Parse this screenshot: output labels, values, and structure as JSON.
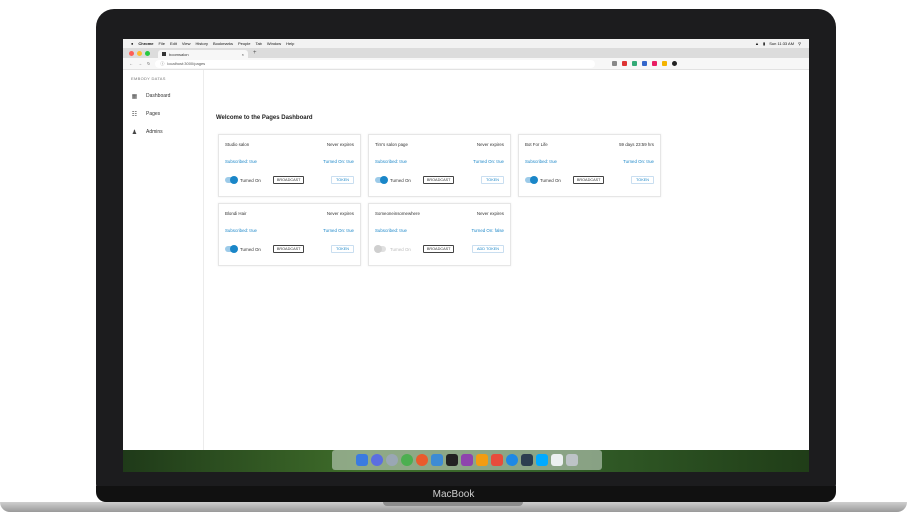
{
  "menubar": {
    "app": "Chrome",
    "items": [
      "File",
      "Edit",
      "View",
      "History",
      "Bookmarks",
      "People",
      "Tab",
      "Window",
      "Help"
    ],
    "clock": "Sun 11:33 AM"
  },
  "tab": {
    "title": "boomsalon",
    "close": "×",
    "new": "+"
  },
  "address": {
    "url": "localhost:3000/pages"
  },
  "sidebar": {
    "title": "EMBODY DATAS",
    "items": [
      {
        "label": "Dashboard",
        "icon": "dashboard-icon"
      },
      {
        "label": "Pages",
        "icon": "cart-icon"
      },
      {
        "label": "Admins",
        "icon": "users-icon"
      }
    ]
  },
  "main": {
    "title": "Welcome to the Pages Dashboard",
    "cards": [
      {
        "name": "Studio salon",
        "expiry": "Never expires",
        "subscribed": "Subscribed: true",
        "turned": "Turned On: true",
        "toggle_label": "Turned On",
        "broadcast": "BROADCAST",
        "token": "TOKEN",
        "on": true
      },
      {
        "name": "Tim's salon page",
        "expiry": "Never expires",
        "subscribed": "Subscribed: true",
        "turned": "Turned On: true",
        "toggle_label": "Turned On",
        "broadcast": "BROADCAST",
        "token": "TOKEN",
        "on": true
      },
      {
        "name": "Bot For Life",
        "expiry": "59 days 23:59 hrs",
        "subscribed": "Subscribed: true",
        "turned": "Turned On: true",
        "toggle_label": "Turned On",
        "broadcast": "BROADCAST",
        "token": "TOKEN",
        "on": true
      },
      {
        "name": "Blondi Hair",
        "expiry": "Never expires",
        "subscribed": "Subscribed: true",
        "turned": "Turned On: true",
        "toggle_label": "Turned On",
        "broadcast": "BROADCAST",
        "token": "TOKEN",
        "on": true
      },
      {
        "name": "Someoneinsomewhere",
        "expiry": "Never expires",
        "subscribed": "Subscribed: true",
        "turned": "Turned On: false",
        "toggle_label": "Turned On",
        "broadcast": "BROADCAST",
        "token": "ADD TOKEN",
        "on": false
      }
    ]
  },
  "device": {
    "brand": "MacBook"
  },
  "colors": {
    "accent": "#1a86c8",
    "toggle_track": "#9dcbe9",
    "lid": "#1c1c1e"
  }
}
